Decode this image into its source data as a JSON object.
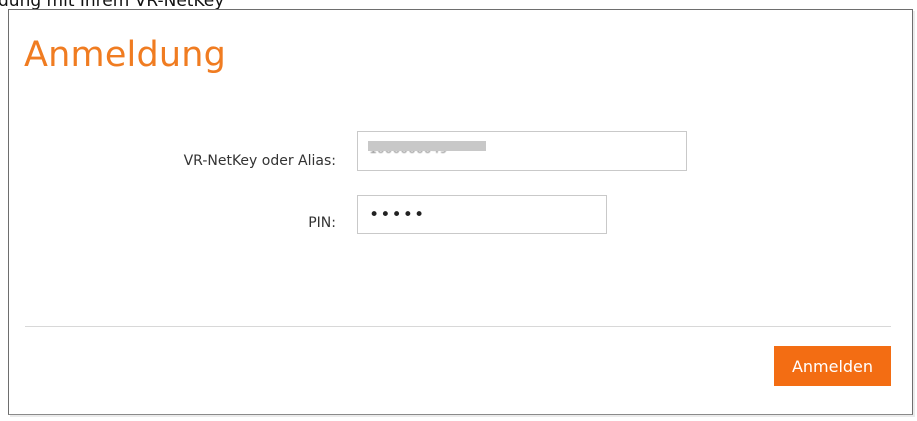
{
  "top_caption": "dung mit Ihrem VR-NetKey",
  "form": {
    "title": "Anmeldung",
    "netkey_label": "VR-NetKey oder Alias:",
    "netkey_value": "1000000049",
    "pin_label": "PIN:",
    "pin_value": "•••••",
    "submit_label": "Anmelden"
  },
  "colors": {
    "accent": "#f07c21",
    "button": "#f36d13"
  }
}
